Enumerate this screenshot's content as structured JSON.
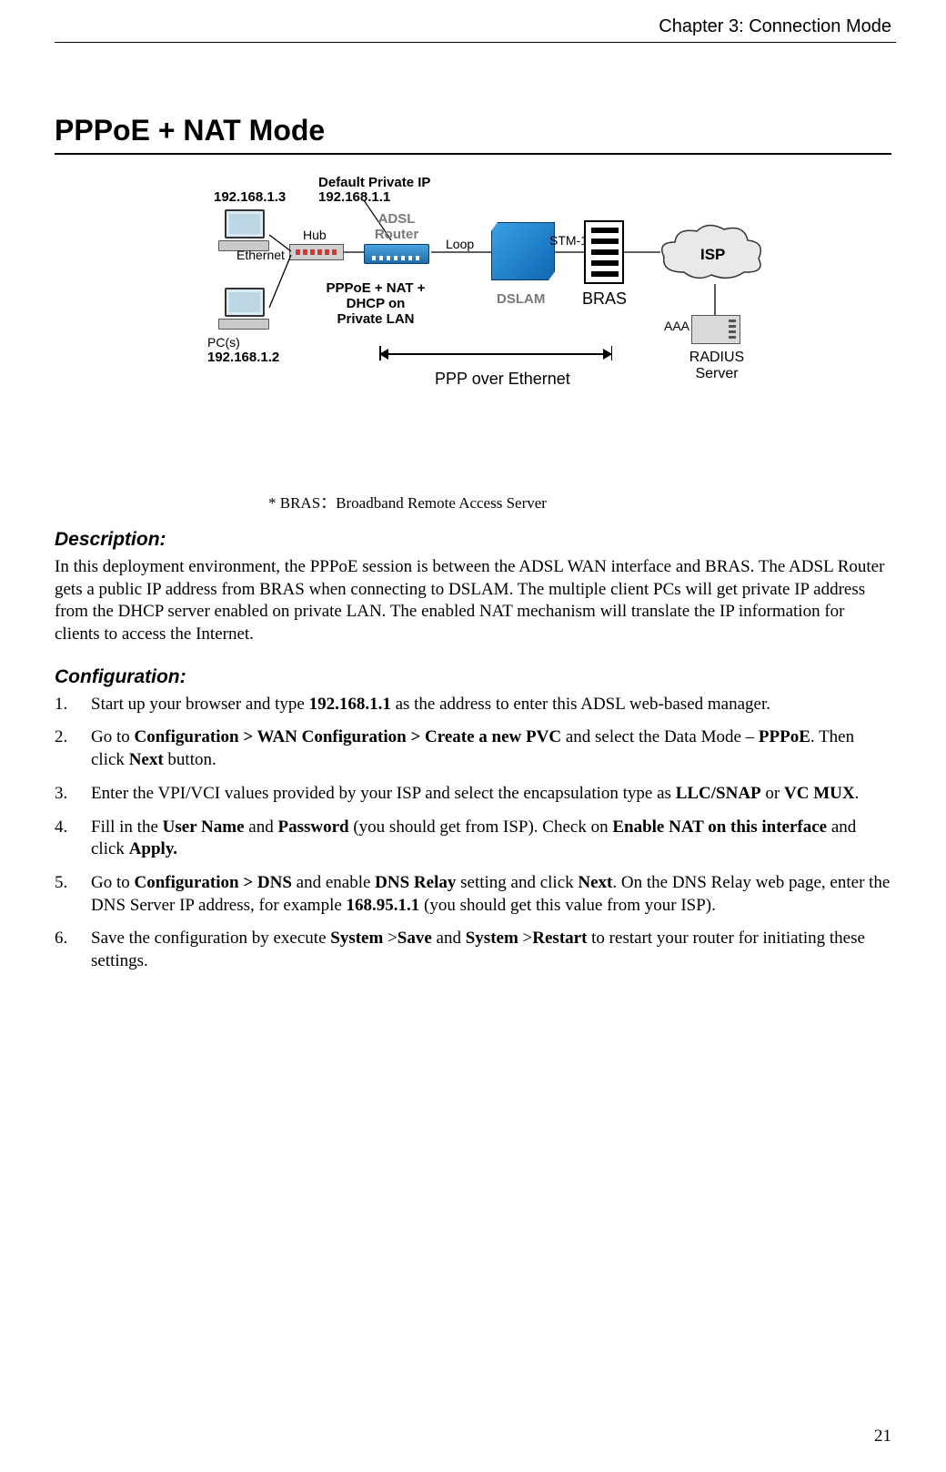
{
  "header": {
    "chapter": "Chapter 3: Connection Mode"
  },
  "title": "PPPoE + NAT Mode",
  "diagram": {
    "pc1_ip": "192.168.1.3",
    "default_ip_label": "Default Private IP",
    "default_ip": "192.168.1.1",
    "hub": "Hub",
    "ethernet": "Ethernet",
    "adsl_router": "ADSL\nRouter",
    "loop": "Loop",
    "stm1": "STM-1",
    "isp": "ISP",
    "mode_label": "PPPoE + NAT +\nDHCP on\nPrivate LAN",
    "dslam": "DSLAM",
    "bras": "BRAS",
    "pcs": "PC(s)",
    "pc2_ip": "192.168.1.2",
    "aaa": "AAA",
    "radius": "RADIUS\nServer",
    "ppp_over_ethernet": "PPP over Ethernet"
  },
  "footnote": "* BRAS：Broadband Remote Access Server",
  "description_heading": "Description:",
  "description_text": "In this deployment environment, the PPPoE session is between the ADSL WAN interface and BRAS. The ADSL Router gets a public IP address from BRAS when connecting to DSLAM. The multiple client PCs will get private IP address from the DHCP server enabled on private LAN. The enabled NAT mechanism will translate the IP information for clients to access the Internet.",
  "configuration_heading": "Configuration:",
  "steps": [
    {
      "pre": "Start up your browser and type ",
      "b1": "192.168.1.1",
      "post": " as the address to enter this ADSL web-based manager."
    },
    {
      "pre": "Go to ",
      "b1": "Configuration > WAN Configuration > Create a new PVC",
      "mid1": " and select the Data Mode – ",
      "b2": "PPPoE",
      "mid2": ". Then click ",
      "b3": "Next",
      "post": " button."
    },
    {
      "pre": "Enter the VPI/VCI values provided by your ISP and select the encapsulation type as ",
      "b1": "LLC/SNAP",
      "mid1": " or ",
      "b2": "VC MUX",
      "post": "."
    },
    {
      "pre": "Fill in the ",
      "b1": "User Name",
      "mid1": " and ",
      "b2": "Password",
      "mid2": " (you should get from ISP). Check on ",
      "b3": "Enable NAT on this interface",
      "mid3": " and click ",
      "b4": "Apply.",
      "post": ""
    },
    {
      "pre": "Go to ",
      "b1": "Configuration > DNS",
      "mid1": " and enable ",
      "b2": "DNS Relay",
      "mid2": " setting and click ",
      "b3": "Next",
      "mid3": ". On the DNS Relay web page, enter the DNS Server IP address, for example ",
      "b4": "168.95.1.1",
      "post": " (you should get this value from your ISP)."
    },
    {
      "pre": "Save the configuration by execute ",
      "b1": "System",
      "mid1": " >",
      "b2": "Save",
      "mid2": " and ",
      "b3": "System",
      "mid3": " >",
      "b4": "Restart",
      "post": " to restart your router for initiating these settings."
    }
  ],
  "page_number": "21"
}
